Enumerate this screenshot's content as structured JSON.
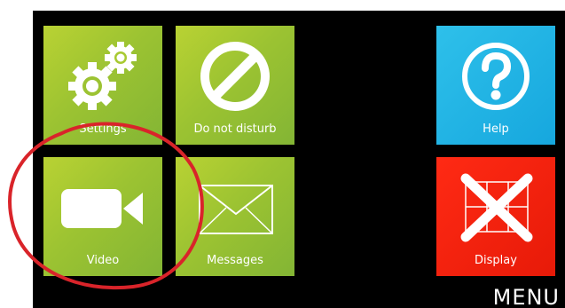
{
  "tiles": {
    "settings": {
      "label": "Settings",
      "icon": "gears-icon"
    },
    "do_not_disturb": {
      "label": "Do not disturb",
      "icon": "prohibited-icon"
    },
    "help": {
      "label": "Help",
      "icon": "question-mark-icon"
    },
    "video": {
      "label": "Video",
      "icon": "video-camera-icon"
    },
    "messages": {
      "label": "Messages",
      "icon": "envelope-icon"
    },
    "display": {
      "label": "Display",
      "icon": "display-cross-icon"
    }
  },
  "menu_label": "MENU",
  "colors": {
    "background": "#000000",
    "green_tile": "#9cc332",
    "blue_tile": "#16a7de",
    "red_tile": "#e71a08",
    "highlight_circle": "#d9242a"
  }
}
